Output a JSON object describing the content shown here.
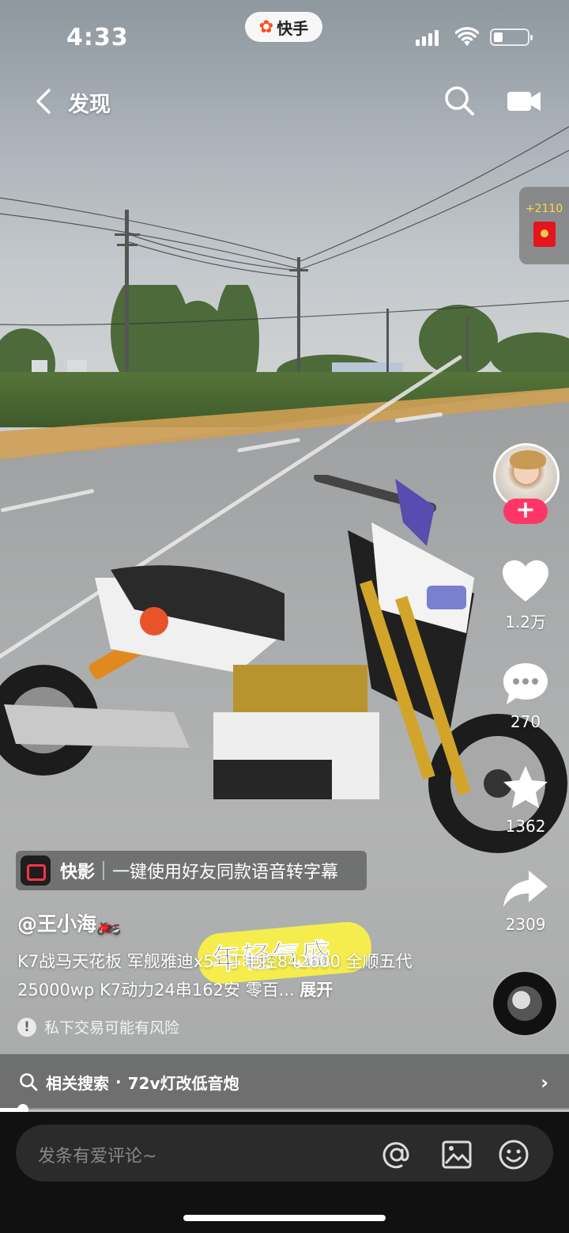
{
  "status_bar": {
    "time": "4:33",
    "app_badge": "快手",
    "signal_bars": 4,
    "battery_level": 0.25
  },
  "nav": {
    "back_icon": "chevron-left-icon",
    "title": "发现",
    "search_icon": "search-icon",
    "screen_cast_icon": "screen-cast-icon"
  },
  "reward": {
    "points": "+2110",
    "icon": "red-envelope-icon"
  },
  "rail": {
    "follow_label": "+",
    "like_count": "1.2万",
    "comment_count": "270",
    "favorite_count": "1362",
    "share_count": "2309"
  },
  "kuaiying": {
    "name": "快影",
    "promo": "一键使用好友同款语音转字幕"
  },
  "post": {
    "author": "@王小海🏍️",
    "description": "K7战马天花板 军舰雅迪x5° 丁电控842600 全顺五代25000wp K7动力24串162安 零百... ",
    "expand_label": "展开",
    "overlay_caption": "年轻气盛",
    "risk_notice": "私下交易可能有风险"
  },
  "related_search": {
    "label": "相关搜索",
    "separator": "·",
    "query": "72v灯改低音炮"
  },
  "playback": {
    "progress": 0.04
  },
  "comment_bar": {
    "placeholder": "发条有爱评论~",
    "icons": [
      "at-icon",
      "image-icon",
      "emoji-icon"
    ]
  },
  "colors": {
    "follow_pink": "#fe3666",
    "brand_orange": "#ff4a1c",
    "overlay_yellow": "#fff640"
  }
}
